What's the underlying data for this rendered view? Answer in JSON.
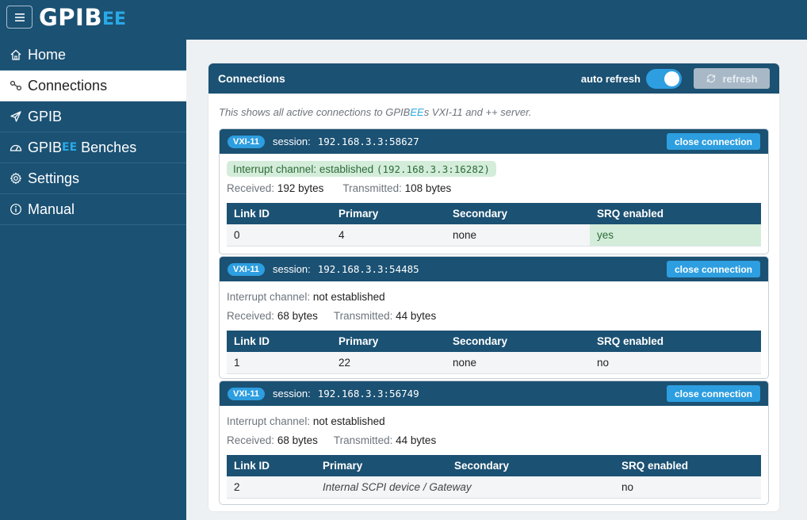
{
  "brand": {
    "main": "GPIB",
    "sub": "EE"
  },
  "sidebar": {
    "items": [
      {
        "label": "Home",
        "icon": "home-icon"
      },
      {
        "label": "Connections",
        "icon": "link-icon"
      },
      {
        "label": "GPIB",
        "icon": "send-icon"
      },
      {
        "label": "GPIB",
        "sub": "EE",
        "suffix": " Benches",
        "icon": "gauge-icon"
      },
      {
        "label": "Settings",
        "icon": "gear-icon"
      },
      {
        "label": "Manual",
        "icon": "info-icon"
      }
    ]
  },
  "panel": {
    "title": "Connections",
    "auto_refresh_label": "auto refresh",
    "auto_refresh_on": true,
    "refresh_label": "refresh",
    "intro_prefix": "This shows all active connections to GPIB",
    "intro_ee": "EE",
    "intro_suffix": "s VXI-11 and ++ server."
  },
  "labels": {
    "session": "session:",
    "close": "close connection",
    "interrupt": "Interrupt channel:",
    "received": "Received:",
    "transmitted": "Transmitted:",
    "columns": [
      "Link ID",
      "Primary",
      "Secondary",
      "SRQ enabled"
    ]
  },
  "connections": [
    {
      "badge": "VXI-11",
      "session": "192.168.3.3:58627",
      "interrupt_text": "established",
      "interrupt_addr": "(192.168.3.3:16282)",
      "received": "192 bytes",
      "transmitted": "108 bytes",
      "row": {
        "link_id": "0",
        "primary": "4",
        "secondary": "none",
        "srq": "yes"
      }
    },
    {
      "badge": "VXI-11",
      "session": "192.168.3.3:54485",
      "interrupt_text": "not established",
      "received": "68 bytes",
      "transmitted": "44 bytes",
      "row": {
        "link_id": "1",
        "primary": "22",
        "secondary": "none",
        "srq": "no"
      }
    },
    {
      "badge": "VXI-11",
      "session": "192.168.3.3:56749",
      "interrupt_text": "not established",
      "received": "68 bytes",
      "transmitted": "44 bytes",
      "row": {
        "link_id": "2",
        "primary": "Internal SCPI device / Gateway",
        "srq": "no"
      }
    }
  ],
  "colors": {
    "navy": "#1b5173",
    "accent": "#2d9ee0",
    "success_bg": "#d4edda"
  }
}
